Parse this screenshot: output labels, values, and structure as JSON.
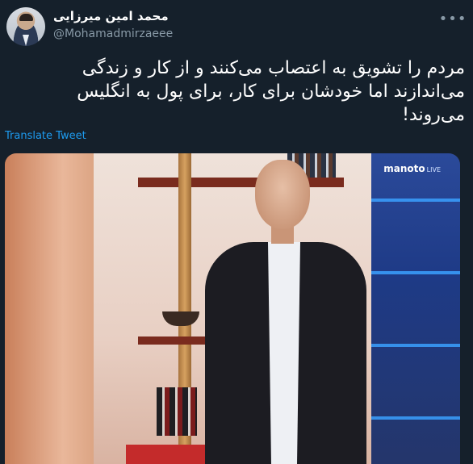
{
  "tweet": {
    "author_name": "محمد امین میرزایی",
    "handle": "@Mohamadmirzaeee",
    "text": "مردم را تشویق به اعتصاب می‌کنند و از کار و زندگی می‌اندازند اما خودشان برای کار، برای پول به انگلیس می‌روند!",
    "translate_label": "Translate Tweet",
    "more_icon": "more-icon"
  },
  "media": {
    "logo_text": "manoto",
    "logo_live": "LIVE",
    "colors": {
      "wall": "#efe2da",
      "right_panel": "#1e3a86",
      "shelf": "#7a2b1e",
      "suit": "#1c1c22"
    }
  },
  "theme": {
    "background": "#15202b",
    "text": "#ffffff",
    "secondary_text": "#8899a6",
    "link": "#1d9bf0"
  }
}
